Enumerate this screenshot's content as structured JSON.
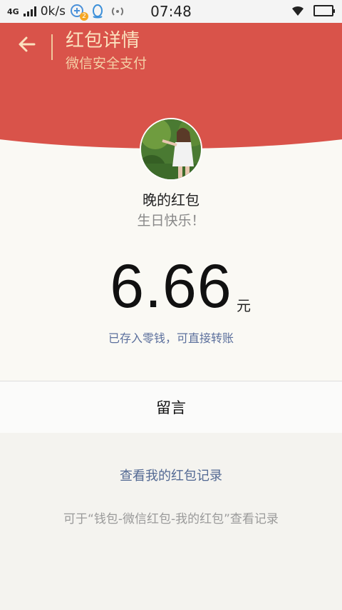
{
  "status_bar": {
    "network": "4G",
    "speed": "0k/s",
    "notification_badge": "2",
    "time": "07:48"
  },
  "header": {
    "title": "红包详情",
    "subtitle": "微信安全支付",
    "color": "#d9534a"
  },
  "sender": {
    "name": "晚的红包",
    "wish": "生日快乐！"
  },
  "amount": {
    "value": "6.66",
    "unit": "元",
    "notice": "已存入零钱，可直接转账"
  },
  "message_row": {
    "label": "留言"
  },
  "footer": {
    "view_records": "查看我的红包记录",
    "hint": "可于“钱包-微信红包-我的红包”查看记录"
  }
}
